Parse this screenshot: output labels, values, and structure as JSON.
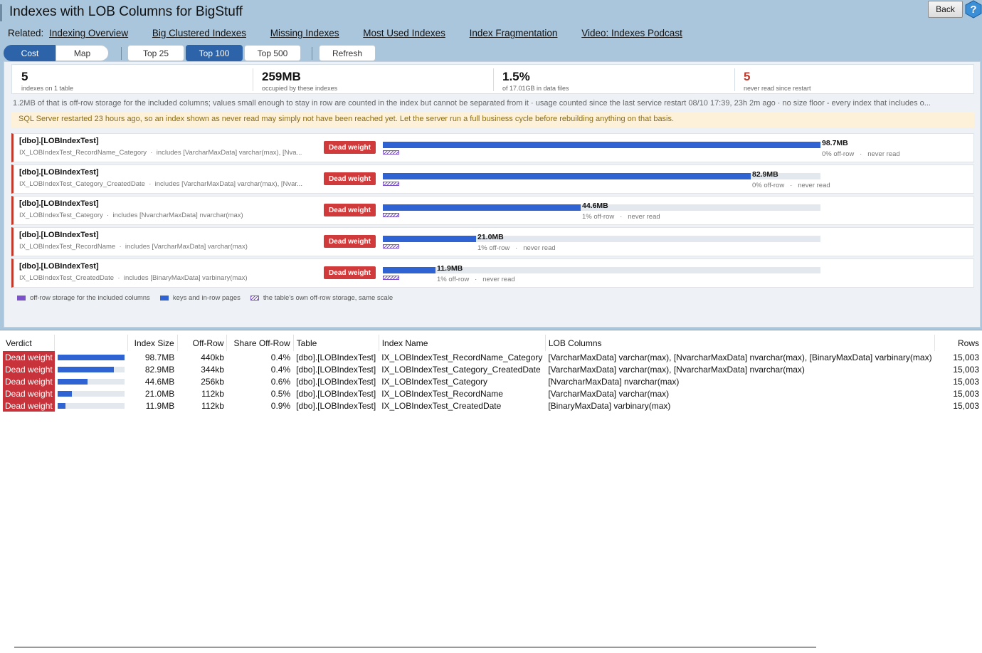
{
  "header": {
    "title": "Indexes with LOB Columns for BigStuff",
    "back_label": "Back",
    "related_label": "Related:",
    "related_links": [
      "Indexing Overview",
      "Big Clustered Indexes",
      "Missing Indexes",
      "Most Used Indexes",
      "Index Fragmentation",
      "Video: Indexes Podcast"
    ]
  },
  "toolbar": {
    "view_toggle": [
      "Cost",
      "Map"
    ],
    "view_active": "Cost",
    "top_options": [
      "Top 25",
      "Top 100",
      "Top 500"
    ],
    "top_active": "Top 100",
    "refresh_label": "Refresh"
  },
  "stats": [
    {
      "value": "5",
      "label": "indexes on 1 table",
      "alert": false
    },
    {
      "value": "259MB",
      "label": "occupied by these indexes",
      "alert": false
    },
    {
      "value": "1.5%",
      "label": "of 17.01GB in data files",
      "alert": false
    },
    {
      "value": "5",
      "label": "never read since restart",
      "alert": true
    }
  ],
  "notes": "1.2MB of that is off-row storage for the included columns; values small enough to stay in row are counted in the index but cannot be separated from it  ·  usage counted since the last service restart 08/10 17:39, 23h 2m ago  ·  no size floor - every index that includes o...",
  "warning": "SQL Server restarted 23 hours ago, so an index shown as never read may simply not have been reached yet. Let the server run a full business cycle before rebuilding anything on that basis.",
  "index_rows": [
    {
      "table": "[dbo].[LOBIndexTest]",
      "index": "IX_LOBIndexTest_RecordName_Category",
      "includes": "includes [VarcharMaxData] varchar(max), [Nva...",
      "verdict": "Dead weight",
      "size": "98.7MB",
      "size_mb": 98.7,
      "offrow": "0% off-row",
      "reads": "never read"
    },
    {
      "table": "[dbo].[LOBIndexTest]",
      "index": "IX_LOBIndexTest_Category_CreatedDate",
      "includes": "includes [VarcharMaxData] varchar(max), [Nvar...",
      "verdict": "Dead weight",
      "size": "82.9MB",
      "size_mb": 82.9,
      "offrow": "0% off-row",
      "reads": "never read"
    },
    {
      "table": "[dbo].[LOBIndexTest]",
      "index": "IX_LOBIndexTest_Category",
      "includes": "includes [NvarcharMaxData] nvarchar(max)",
      "verdict": "Dead weight",
      "size": "44.6MB",
      "size_mb": 44.6,
      "offrow": "1% off-row",
      "reads": "never read"
    },
    {
      "table": "[dbo].[LOBIndexTest]",
      "index": "IX_LOBIndexTest_RecordName",
      "includes": "includes [VarcharMaxData] varchar(max)",
      "verdict": "Dead weight",
      "size": "21.0MB",
      "size_mb": 21.0,
      "offrow": "1% off-row",
      "reads": "never read"
    },
    {
      "table": "[dbo].[LOBIndexTest]",
      "index": "IX_LOBIndexTest_CreatedDate",
      "includes": "includes [BinaryMaxData] varbinary(max)",
      "verdict": "Dead weight",
      "size": "11.9MB",
      "size_mb": 11.9,
      "offrow": "1% off-row",
      "reads": "never read"
    }
  ],
  "max_size_mb": 98.7,
  "legend": [
    "off-row storage for the included columns",
    "keys and in-row pages",
    "the table's own off-row storage, same scale"
  ],
  "grid": {
    "columns": [
      "Verdict",
      "",
      "Index Size",
      "Off-Row",
      "Share Off-Row",
      "Table",
      "Index Name",
      "LOB Columns",
      "Rows"
    ],
    "rows": [
      {
        "verdict": "Dead weight",
        "size": "98.7MB",
        "size_mb": 98.7,
        "offrow": "440kb",
        "share": "0.4%",
        "table": "[dbo].[LOBIndexTest]",
        "index": "IX_LOBIndexTest_RecordName_Category",
        "lob": "[VarcharMaxData] varchar(max), [NvarcharMaxData] nvarchar(max), [BinaryMaxData] varbinary(max)",
        "rows": "15,003"
      },
      {
        "verdict": "Dead weight",
        "size": "82.9MB",
        "size_mb": 82.9,
        "offrow": "344kb",
        "share": "0.4%",
        "table": "[dbo].[LOBIndexTest]",
        "index": "IX_LOBIndexTest_Category_CreatedDate",
        "lob": "[VarcharMaxData] varchar(max), [NvarcharMaxData] nvarchar(max)",
        "rows": "15,003"
      },
      {
        "verdict": "Dead weight",
        "size": "44.6MB",
        "size_mb": 44.6,
        "offrow": "256kb",
        "share": "0.6%",
        "table": "[dbo].[LOBIndexTest]",
        "index": "IX_LOBIndexTest_Category",
        "lob": "[NvarcharMaxData] nvarchar(max)",
        "rows": "15,003"
      },
      {
        "verdict": "Dead weight",
        "size": "21.0MB",
        "size_mb": 21.0,
        "offrow": "112kb",
        "share": "0.5%",
        "table": "[dbo].[LOBIndexTest]",
        "index": "IX_LOBIndexTest_RecordName",
        "lob": "[VarcharMaxData] varchar(max)",
        "rows": "15,003"
      },
      {
        "verdict": "Dead weight",
        "size": "11.9MB",
        "size_mb": 11.9,
        "offrow": "112kb",
        "share": "0.9%",
        "table": "[dbo].[LOBIndexTest]",
        "index": "IX_LOBIndexTest_CreatedDate",
        "lob": "[BinaryMaxData] varbinary(max)",
        "rows": "15,003"
      }
    ]
  },
  "colors": {
    "accent": "#2c63a9",
    "bar": "#2f62d3",
    "offrow": "#7b52c9",
    "alert": "#c0392b",
    "verdict": "#c8323a"
  }
}
